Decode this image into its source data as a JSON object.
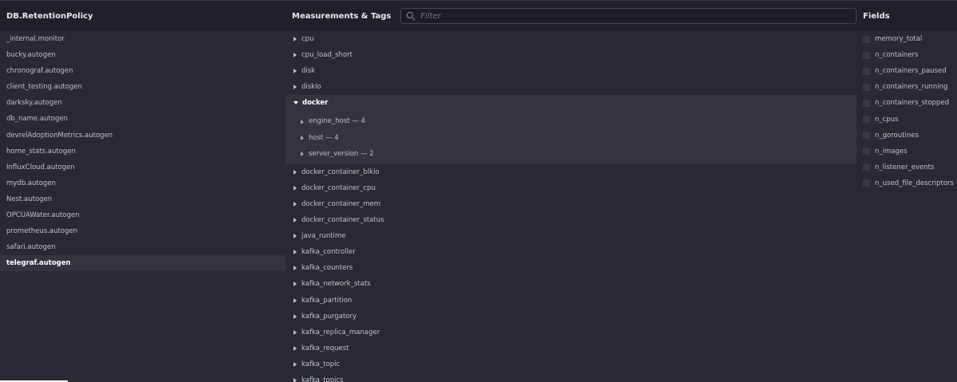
{
  "db_column": {
    "title": "DB.RetentionPolicy",
    "items": [
      "_internal.monitor",
      "bucky.autogen",
      "chronograf.autogen",
      "client_testing.autogen",
      "darksky.autogen",
      "db_name.autogen",
      "devrelAdoptionMetrics.autogen",
      "home_stats.autogen",
      "InfluxCloud.autogen",
      "mydb.autogen",
      "Nest.autogen",
      "OPCUAWater.autogen",
      "prometheus.autogen",
      "safari.autogen",
      "telegraf.autogen"
    ],
    "selected": "telegraf.autogen"
  },
  "measurements_column": {
    "title": "Measurements & Tags",
    "filter_placeholder": "Filter",
    "before_expanded": [
      "cpu",
      "cpu_load_short",
      "disk",
      "diskio"
    ],
    "expanded": {
      "name": "docker",
      "tags": [
        "engine_host — 4",
        "host — 4",
        "server_version — 2"
      ]
    },
    "after_expanded": [
      "docker_container_blkio",
      "docker_container_cpu",
      "docker_container_mem",
      "docker_container_status",
      "java_runtime",
      "kafka_controller",
      "kafka_counters",
      "kafka_network_stats",
      "kafka_partition",
      "kafka_purgatory",
      "kafka_replica_manager",
      "kafka_request",
      "kafka_topic",
      "kafka_topics"
    ]
  },
  "fields_column": {
    "title": "Fields",
    "items": [
      "memory_total",
      "n_containers",
      "n_containers_paused",
      "n_containers_running",
      "n_containers_stopped",
      "n_cpus",
      "n_goroutines",
      "n_images",
      "n_listener_events",
      "n_used_file_descriptors"
    ]
  },
  "colors": {
    "background": "#292933",
    "header": "#202028",
    "selected_row": "#34343f",
    "text": "#bec2cc",
    "text_active": "#ffffff"
  }
}
